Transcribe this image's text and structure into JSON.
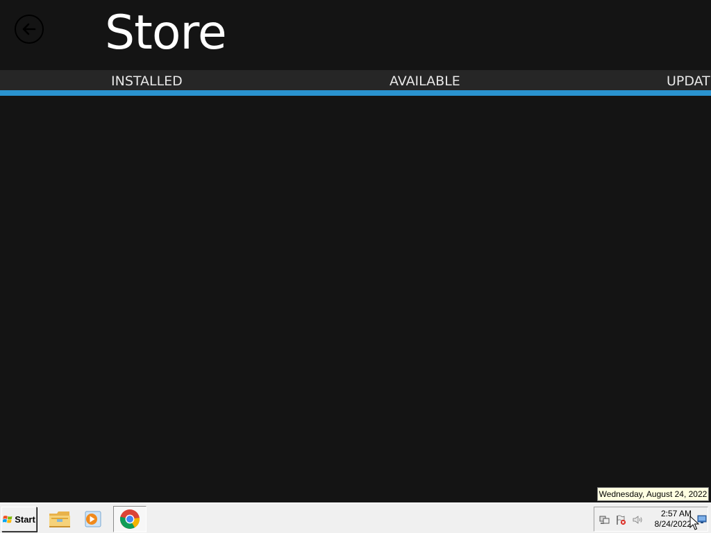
{
  "app": {
    "title": "Store",
    "back_icon": "back-arrow-icon",
    "tabs": [
      {
        "label": "INSTALLED"
      },
      {
        "label": "AVAILABLE"
      },
      {
        "label": "UPDATES"
      }
    ],
    "accent_color": "#2a93cf",
    "background_color": "#141414"
  },
  "tooltip": {
    "text": "Wednesday, August 24, 2022"
  },
  "taskbar": {
    "start_label": "Start",
    "start_icon": "windows-logo-icon",
    "quick_launch": [
      {
        "icon": "file-explorer-icon"
      },
      {
        "icon": "media-player-icon"
      }
    ],
    "tasks": [
      {
        "icon": "chrome-icon"
      }
    ],
    "tray": {
      "icons": [
        "network-icon",
        "action-center-flag-icon",
        "volume-icon"
      ],
      "time": "2:57 AM",
      "date": "8/24/2022"
    }
  }
}
